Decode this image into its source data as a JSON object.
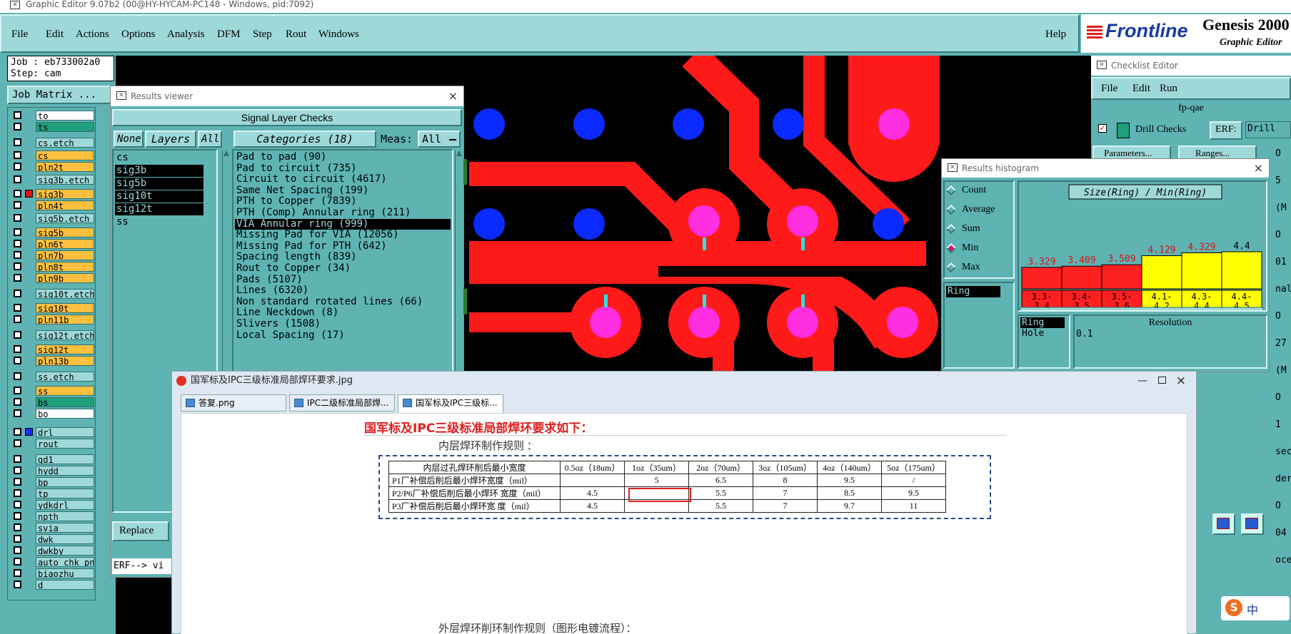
{
  "window_title": "Graphic Editor 9.07b2 (00@HY-HYCAM-PC148 - Windows, pid:7092)",
  "menu": [
    "File",
    "Edit",
    "Actions",
    "Options",
    "Analysis",
    "DFM",
    "Step",
    "Rout",
    "Windows"
  ],
  "help": "Help",
  "logo": {
    "brand": "Frontline",
    "product": "Genesis 2000",
    "subtitle": "Graphic Editor"
  },
  "job": {
    "job_line": "Job : eb733002a0",
    "step_line": "Step: cam",
    "matrix_button": "Job Matrix ..."
  },
  "layers": [
    {
      "name": "to",
      "color": "#ffffff"
    },
    {
      "name": "ts",
      "color": "#1fa07a"
    },
    {
      "name": "cs.etch",
      "color": "#9fd8d8"
    },
    {
      "name": "cs",
      "color": "#ffc040"
    },
    {
      "name": "pln2t",
      "color": "#ffc040"
    },
    {
      "name": "sig3b.etch",
      "color": "#9fd8d8"
    },
    {
      "name": "sig3b",
      "color": "#ffc040",
      "active": true
    },
    {
      "name": "pln4t",
      "color": "#ffc040"
    },
    {
      "name": "sig5b.etch",
      "color": "#9fd8d8"
    },
    {
      "name": "sig5b",
      "color": "#ffc040"
    },
    {
      "name": "pln6t",
      "color": "#ffc040"
    },
    {
      "name": "pln7b",
      "color": "#ffc040"
    },
    {
      "name": "pln8t",
      "color": "#ffc040"
    },
    {
      "name": "pln9b",
      "color": "#ffc040"
    },
    {
      "name": "sig10t.etch",
      "color": "#9fd8d8"
    },
    {
      "name": "sig10t",
      "color": "#ffc040"
    },
    {
      "name": "pln11b",
      "color": "#ffc040"
    },
    {
      "name": "sig12t.etch",
      "color": "#9fd8d8"
    },
    {
      "name": "sig12t",
      "color": "#ffc040"
    },
    {
      "name": "pln13b",
      "color": "#ffc040"
    },
    {
      "name": "ss.etch",
      "color": "#9fd8d8"
    },
    {
      "name": "ss",
      "color": "#ffc040"
    },
    {
      "name": "bs",
      "color": "#1fa07a"
    },
    {
      "name": "bo",
      "color": "#ffffff"
    },
    {
      "name": "drl",
      "color": "#9fd8d8",
      "blue": true
    },
    {
      "name": "rout",
      "color": "#9fd8d8"
    },
    {
      "name": "gd1",
      "color": "#9fd8d8"
    },
    {
      "name": "hydd",
      "color": "#9fd8d8"
    },
    {
      "name": "bp",
      "color": "#9fd8d8"
    },
    {
      "name": "tp",
      "color": "#9fd8d8"
    },
    {
      "name": "ydkdrl",
      "color": "#9fd8d8"
    },
    {
      "name": "npth",
      "color": "#9fd8d8"
    },
    {
      "name": "svia",
      "color": "#9fd8d8"
    },
    {
      "name": "dwk",
      "color": "#9fd8d8"
    },
    {
      "name": "dwkby",
      "color": "#9fd8d8"
    },
    {
      "name": "auto_chk_pn",
      "color": "#9fd8d8"
    },
    {
      "name": "biaozhu",
      "color": "#9fd8d8"
    },
    {
      "name": "d",
      "color": "#9fd8d8"
    }
  ],
  "results_viewer": {
    "title": "Results viewer",
    "header": "Signal Layer Checks",
    "none_btn": "None",
    "layers_btn": "Layers",
    "all_btn": "All",
    "categories_btn": "Categories (18)",
    "meas_label": "Meas:",
    "meas_value": "All",
    "layer_list": [
      "cs",
      "sig3b",
      "sig5b",
      "sig10t",
      "sig12t",
      "ss"
    ],
    "selected_layers": [
      "sig3b",
      "sig5b",
      "sig10t",
      "sig12t"
    ],
    "categories": [
      "Pad to pad (90)",
      "Pad to circuit (735)",
      "Circuit to circuit (4617)",
      "Same Net Spacing (199)",
      "PTH to Copper (7839)",
      "PTH (Comp) Annular ring (211)",
      "VIA Annular ring (999)",
      "Missing Pad for VIA (12056)",
      "Missing Pad for PTH (642)",
      "Spacing length (839)",
      "Rout to Copper (34)",
      "Pads (5107)",
      "Lines (6320)",
      "Non standard rotated lines (66)",
      "Line Neckdown (8)",
      "Slivers (1508)",
      "Local Spacing (17)"
    ],
    "selected_category": "VIA Annular ring (999)",
    "replace_btn": "Replace",
    "erf_text": "ERF--> vi"
  },
  "checklist_editor": {
    "title": "Checklist Editor",
    "menu": [
      "File",
      "Edit",
      "Run"
    ],
    "checklist_name": "fp-qae",
    "action": "Drill Checks",
    "erf_label": "ERF:",
    "erf_value": "Drill",
    "params_btn": "Parameters...",
    "ranges_btn": "Ranges...",
    "edge": [
      "O",
      "5",
      "(M",
      "O",
      "01",
      "nal",
      "O",
      "27",
      "(M",
      "O",
      "1",
      "sec",
      "dern",
      "O",
      "04",
      "oce"
    ]
  },
  "histogram": {
    "title": "Results histogram",
    "options": [
      "Count",
      "Average",
      "Sum",
      "Min",
      "Max"
    ],
    "selected_option": "Min",
    "list_item": "Ring",
    "chart_title": "Size(Ring) / Min(Ring)",
    "bottom_items": [
      "Ring",
      "Hole"
    ],
    "resolution_label": "Resolution",
    "resolution_value": "0.1"
  },
  "chart_data": {
    "type": "bar",
    "title": "Size(Ring) / Min(Ring)",
    "categories": [
      "3.3-3.4",
      "3.4-3.5",
      "3.5-3.6",
      "4.1-4.2",
      "4.3-4.4",
      "4.4-4.5"
    ],
    "values": [
      3.329,
      3.409,
      3.509,
      4.129,
      4.329,
      4.4
    ],
    "value_labels": [
      "3.329",
      "3.409",
      "3.509",
      "4.129",
      "4.329",
      "4.4"
    ],
    "colors": [
      "#ff2020",
      "#ff2020",
      "#ff2020",
      "#ffff00",
      "#ffff00",
      "#ffff00"
    ]
  },
  "image_viewer": {
    "title": "国军标及IPC三级标准局部焊环要求.jpg",
    "tabs": [
      "答复.png",
      "IPC二级标准局部焊...",
      "国军标及IPC三级标..."
    ],
    "active_tab": 2,
    "heading": "国军标及IPC三级标准局部焊环要求如下：",
    "inner_rule": "内层焊环制作规则 ：",
    "table_header": [
      "内层过孔焊环削后最小宽度",
      "0.5oz（18um）",
      "1oz（35um）",
      "2oz（70um）",
      "3oz（105um）",
      "4oz（140um）",
      "5oz（175um）"
    ],
    "table_rows": [
      [
        "P1厂补偿后削后最小焊环宽度（mil）",
        "",
        "5",
        "6.5",
        "8",
        "9.5",
        "/"
      ],
      [
        "P2/P6厂补偿后削后最小焊环 宽度（mil）",
        "4.5",
        "",
        "5.5",
        "7",
        "8.5",
        "9.5"
      ],
      [
        "P3厂补偿后削后最小焊环宽 度（mil）",
        "4.5",
        "",
        "5.5",
        "7",
        "9.7",
        "11"
      ]
    ],
    "outer_rule": "外层焊环削环制作规则（图形电镀流程）："
  },
  "ime": {
    "label": "中"
  }
}
